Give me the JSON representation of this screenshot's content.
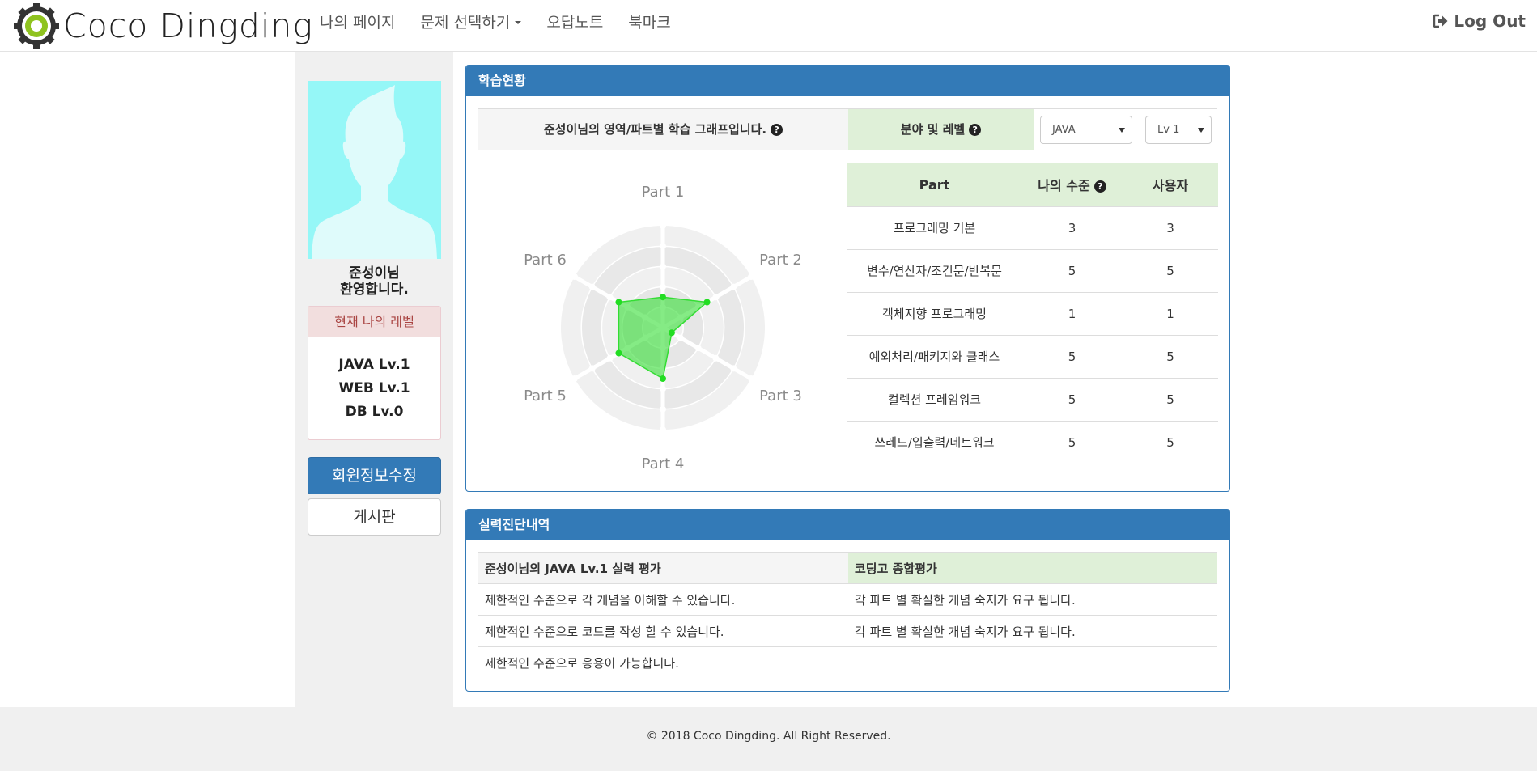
{
  "brand": {
    "name": "Coco Dingding"
  },
  "nav": {
    "items": [
      "나의 페이지",
      "문제 선택하기",
      "오답노트",
      "북마크"
    ],
    "logout": "Log Out"
  },
  "sidebar": {
    "welcome_line1": "준성이님",
    "welcome_line2": "환영합니다.",
    "level_heading": "현재 나의 레벨",
    "levels": [
      "JAVA Lv.1",
      "WEB Lv.1",
      "DB Lv.0"
    ],
    "edit_profile_button": "회원정보수정",
    "board_button": "게시판"
  },
  "study": {
    "panel_title": "학습현황",
    "graph_title": "준성이님의 영역/파트별 학습 그래프입니다.",
    "field_level_label": "분야 및 레벨",
    "field_select": "JAVA",
    "level_select": "Lv 1",
    "radar_labels": [
      "Part 1",
      "Part 2",
      "Part 3",
      "Part 4",
      "Part 5",
      "Part 6"
    ],
    "radar_values": [
      3,
      5,
      1,
      5,
      5,
      5
    ],
    "radar_max": 10,
    "table_headers": [
      "Part",
      "나의 수준",
      "사용자"
    ],
    "parts": [
      {
        "name": "프로그래밍 기본",
        "mine": "3",
        "users": "3"
      },
      {
        "name": "변수/연산자/조건문/반복문",
        "mine": "5",
        "users": "5"
      },
      {
        "name": "객체지향 프로그래밍",
        "mine": "1",
        "users": "1"
      },
      {
        "name": "예외처리/패키지와 클래스",
        "mine": "5",
        "users": "5"
      },
      {
        "name": "컬렉션 프레임워크",
        "mine": "5",
        "users": "5"
      },
      {
        "name": "쓰레드/입출력/네트워크",
        "mine": "5",
        "users": "5"
      }
    ],
    "colors": {
      "radar_fill": "#33dd33",
      "radar_point": "#22dd22"
    }
  },
  "diagnosis": {
    "panel_title": "실력진단내역",
    "col1_header": "준성이님의 JAVA Lv.1 실력 평가",
    "col2_header": "코딩고 종합평가",
    "rows": [
      {
        "left": "제한적인 수준으로 각 개념을 이해할 수 있습니다.",
        "right": "각 파트 별 확실한 개념 숙지가 요구 됩니다."
      },
      {
        "left": "제한적인 수준으로 코드를 작성 할 수 있습니다.",
        "right": "각 파트 별 확실한 개념 숙지가 요구 됩니다."
      },
      {
        "left": "제한적인 수준으로 응용이 가능합니다.",
        "right": ""
      }
    ]
  },
  "footer": {
    "text": "© 2018 Coco Dingding. All Right Reserved."
  }
}
